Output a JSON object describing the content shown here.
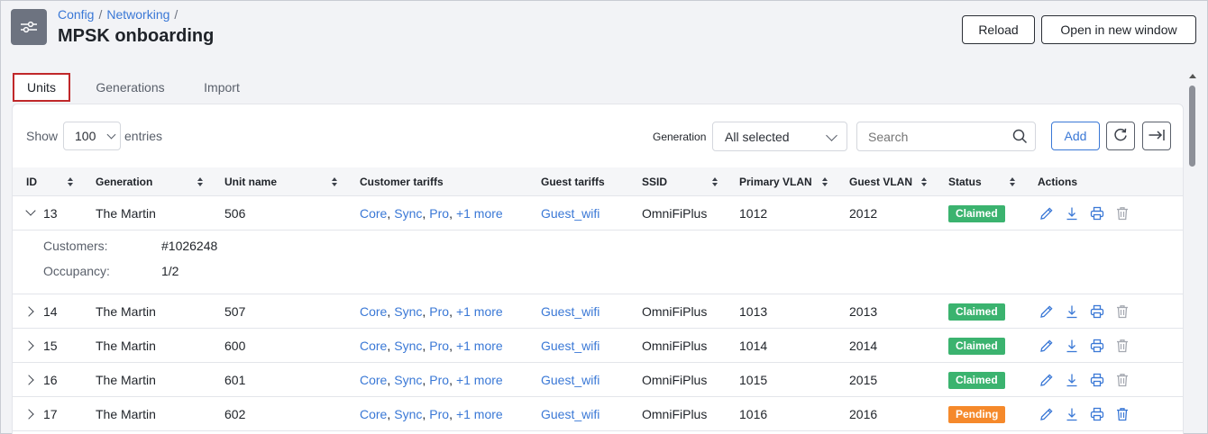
{
  "breadcrumb": [
    "Config",
    "Networking"
  ],
  "breadcrumb_sep": "/",
  "page_title": "MPSK onboarding",
  "header_buttons": {
    "reload": "Reload",
    "open_new_window": "Open in new window"
  },
  "tabs": [
    {
      "label": "Units",
      "active": true
    },
    {
      "label": "Generations",
      "active": false
    },
    {
      "label": "Import",
      "active": false
    }
  ],
  "toolbar": {
    "show_label": "Show",
    "entries_value": "100",
    "entries_label": "entries",
    "generation_label": "Generation",
    "generation_value": "All selected",
    "search_placeholder": "Search",
    "add_label": "Add"
  },
  "columns": [
    "ID",
    "Generation",
    "Unit name",
    "Customer tariffs",
    "Guest tariffs",
    "SSID",
    "Primary VLAN",
    "Guest VLAN",
    "Status",
    "Actions"
  ],
  "rows": [
    {
      "id": "13",
      "generation": "The Martin",
      "unit": "506",
      "tariffs": [
        "Core",
        "Sync",
        "Pro",
        "+1 more"
      ],
      "guest": "Guest_wifi",
      "ssid": "OmniFiPlus",
      "pvlan": "1012",
      "gvlan": "2012",
      "status": "Claimed",
      "expanded": true
    },
    {
      "id": "14",
      "generation": "The Martin",
      "unit": "507",
      "tariffs": [
        "Core",
        "Sync",
        "Pro",
        "+1 more"
      ],
      "guest": "Guest_wifi",
      "ssid": "OmniFiPlus",
      "pvlan": "1013",
      "gvlan": "2013",
      "status": "Claimed",
      "expanded": false
    },
    {
      "id": "15",
      "generation": "The Martin",
      "unit": "600",
      "tariffs": [
        "Core",
        "Sync",
        "Pro",
        "+1 more"
      ],
      "guest": "Guest_wifi",
      "ssid": "OmniFiPlus",
      "pvlan": "1014",
      "gvlan": "2014",
      "status": "Claimed",
      "expanded": false
    },
    {
      "id": "16",
      "generation": "The Martin",
      "unit": "601",
      "tariffs": [
        "Core",
        "Sync",
        "Pro",
        "+1 more"
      ],
      "guest": "Guest_wifi",
      "ssid": "OmniFiPlus",
      "pvlan": "1015",
      "gvlan": "2015",
      "status": "Claimed",
      "expanded": false
    },
    {
      "id": "17",
      "generation": "The Martin",
      "unit": "602",
      "tariffs": [
        "Core",
        "Sync",
        "Pro",
        "+1 more"
      ],
      "guest": "Guest_wifi",
      "ssid": "OmniFiPlus",
      "pvlan": "1016",
      "gvlan": "2016",
      "status": "Pending",
      "expanded": false
    }
  ],
  "detail": {
    "customers_label": "Customers:",
    "customers_value": "#1026248",
    "occupancy_label": "Occupancy:",
    "occupancy_value": "1/2"
  },
  "status_colors": {
    "Claimed": "#3bb36f",
    "Pending": "#f5892b"
  },
  "accent_color": "#3a78d6",
  "icons": [
    "settings-sliders-icon",
    "search-icon",
    "refresh-icon",
    "export-icon",
    "edit-icon",
    "download-icon",
    "print-icon",
    "delete-icon"
  ]
}
